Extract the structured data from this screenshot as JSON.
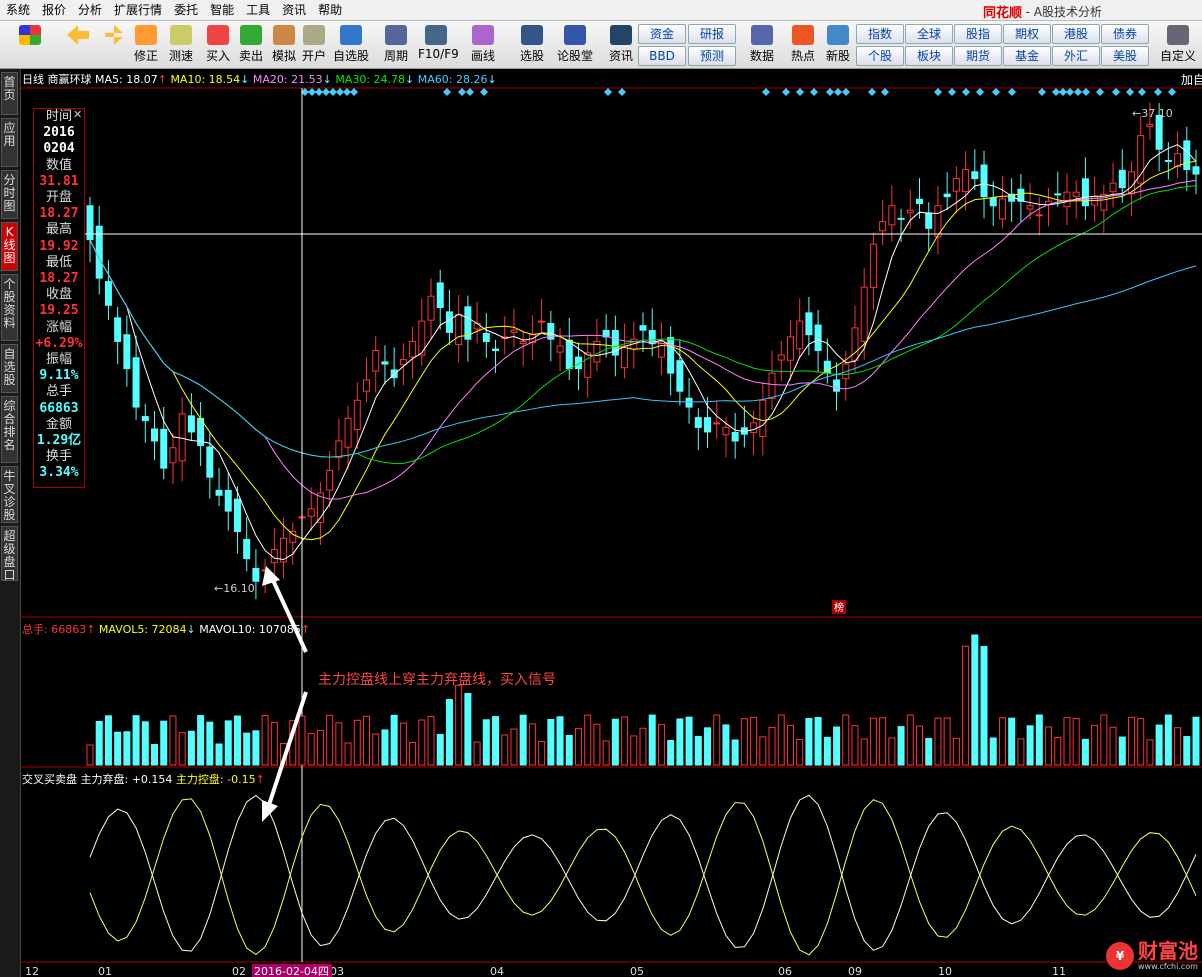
{
  "menu": [
    "系统",
    "报价",
    "分析",
    "扩展行情",
    "委托",
    "智能",
    "工具",
    "资讯",
    "帮助"
  ],
  "brand": "同花顺",
  "brand_sub": "- A股技术分析",
  "toolbar": {
    "buttons": [
      "修正",
      "测速",
      "买入",
      "卖出",
      "模拟",
      "开户",
      "自选股",
      "周期",
      "F10/F9",
      "画线",
      "选股",
      "论股堂",
      "资讯",
      "数据",
      "热点",
      "新股",
      "自定义"
    ],
    "grid1": [
      "资金",
      "研报",
      "BBD",
      "预测"
    ],
    "grid2": [
      "指数",
      "全球",
      "股指",
      "期权",
      "港股",
      "债券",
      "个股",
      "板块",
      "期货",
      "基金",
      "外汇",
      "美股"
    ]
  },
  "sidebar": [
    "首页",
    "应用",
    "分时图",
    "K线图",
    "个股资料",
    "自选股",
    "综合排名",
    "牛叉诊股",
    "超级盘口"
  ],
  "header": {
    "period": "日线",
    "stock": "商赢环球",
    "ma5": "MA5: 18.07",
    "ma10": "MA10: 18.54",
    "ma20": "MA20: 21.53",
    "ma30": "MA30: 24.78",
    "ma60": "MA60: 28.26",
    "add": "加自"
  },
  "info": {
    "time_label": "时间",
    "year": "2016",
    "date": "0204",
    "value_label": "数值",
    "value": "31.81",
    "open_label": "开盘",
    "open": "18.27",
    "high_label": "最高",
    "high": "19.92",
    "low_label": "最低",
    "low": "18.27",
    "close_label": "收盘",
    "close": "19.25",
    "change_label": "涨幅",
    "change": "+6.29%",
    "amp_label": "振幅",
    "amp": "9.11%",
    "vol_label": "总手",
    "vol": "66863",
    "amt_label": "金额",
    "amt": "1.29亿",
    "turn_label": "换手",
    "turn": "3.34%"
  },
  "labels": {
    "high_mark": "37.10",
    "low_mark": "16.10",
    "bang": "榜",
    "annotation": "主力控盘线上穿主力弃盘线，买入信号",
    "vol_hdr_total": "总手: 66863",
    "vol_hdr_ma5": "MAVOL5: 72084",
    "vol_hdr_ma10": "MAVOL10: 107085",
    "ind_hdr_name": "交叉买卖盘 主力弃盘: +0.154",
    "ind_hdr_ctrl": "主力控盘: -0.15",
    "date_cursor": "2016-02-04四",
    "watermark": "财富池",
    "watermark_url": "www.cfchi.com"
  },
  "colors": {
    "up": "#ff3232",
    "down": "#54ffff",
    "ma5": "#ffffff",
    "ma10": "#ffff00",
    "ma20": "#ff80ff",
    "ma30": "#00e000",
    "ma60": "#40c0ff"
  },
  "chart_data": {
    "type": "candlestick",
    "x_labels": [
      "12",
      "01",
      "02",
      "03",
      "04",
      "05",
      "06",
      "09",
      "10",
      "11"
    ],
    "ylim": [
      16.1,
      37.1
    ],
    "price": [
      31.5,
      29.8,
      28.6,
      27.0,
      25.8,
      24.1,
      23.5,
      22.6,
      21.4,
      22.3,
      23.8,
      23.0,
      22.4,
      21.0,
      20.2,
      19.5,
      18.6,
      17.4,
      16.4,
      16.9,
      17.8,
      18.3,
      18.6,
      19.25,
      19.6,
      20.3,
      21.3,
      22.6,
      23.6,
      24.4,
      25.3,
      26.6,
      26.0,
      25.4,
      26.2,
      27.0,
      27.9,
      29.0,
      28.5,
      27.4,
      28.2,
      27.1,
      27.8,
      27.0,
      26.6,
      27.2,
      27.5,
      27.0,
      27.3,
      27.9,
      27.1,
      26.8,
      25.8,
      25.8,
      26.5,
      27.0,
      27.2,
      26.4,
      26.8,
      27.1,
      27.5,
      26.9,
      27.0,
      25.6,
      24.8,
      24.1,
      23.2,
      23.0,
      23.4,
      23.2,
      22.6,
      22.9,
      23.4,
      24.4,
      25.6,
      26.4,
      27.2,
      27.9,
      27.3,
      26.6,
      25.6,
      24.8,
      26.0,
      27.6,
      29.4,
      31.3,
      32.3,
      33.0,
      32.4,
      32.8,
      33.1,
      32.0,
      33.0,
      33.4,
      34.2,
      34.6,
      34.2,
      33.4,
      33.0,
      33.3,
      33.2,
      33.2,
      33.0,
      32.6,
      33.2,
      33.5,
      33.6,
      33.6,
      33.0,
      33.4,
      33.5,
      34.0,
      33.8,
      34.5,
      36.1,
      36.6,
      35.5,
      35.0,
      35.3,
      34.6,
      34.4
    ]
  }
}
